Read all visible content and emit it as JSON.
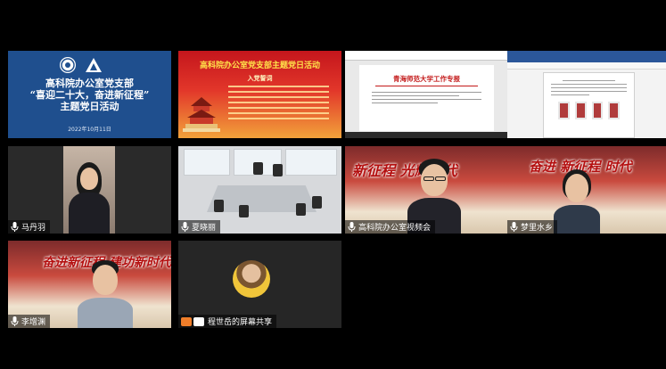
{
  "slides": {
    "slide1": {
      "title_line1": "高科院办公室党支部",
      "title_line2": "“喜迎二十大，奋进新征程”",
      "title_line3": "主题党日活动",
      "date": "2022年10月11日"
    },
    "slide2": {
      "title": "高科院办公室党支部主题党日活动",
      "subtitle": "入党誓词"
    },
    "slide3": {
      "title": "青海师范大学工作专报"
    }
  },
  "participants": [
    {
      "name": "马丹羽"
    },
    {
      "name": "夏晓丽"
    },
    {
      "name": "高科院办公室视频会"
    },
    {
      "name": "梦里水乡"
    },
    {
      "name": "李增渊"
    },
    {
      "name": "程世岳的屏幕共享"
    }
  ],
  "banners": {
    "t7": "新征程  光辉时代",
    "t8": "奋进 新征程  时代",
    "t9": "奋进新征程  建功新时代"
  },
  "colors": {
    "mic": "#ffffff",
    "share_orange": "#f07e2a",
    "share_white": "#ffffff",
    "doc_red": "#c31a1a"
  },
  "icons": [
    "microphone-icon",
    "screen-share-icon"
  ]
}
